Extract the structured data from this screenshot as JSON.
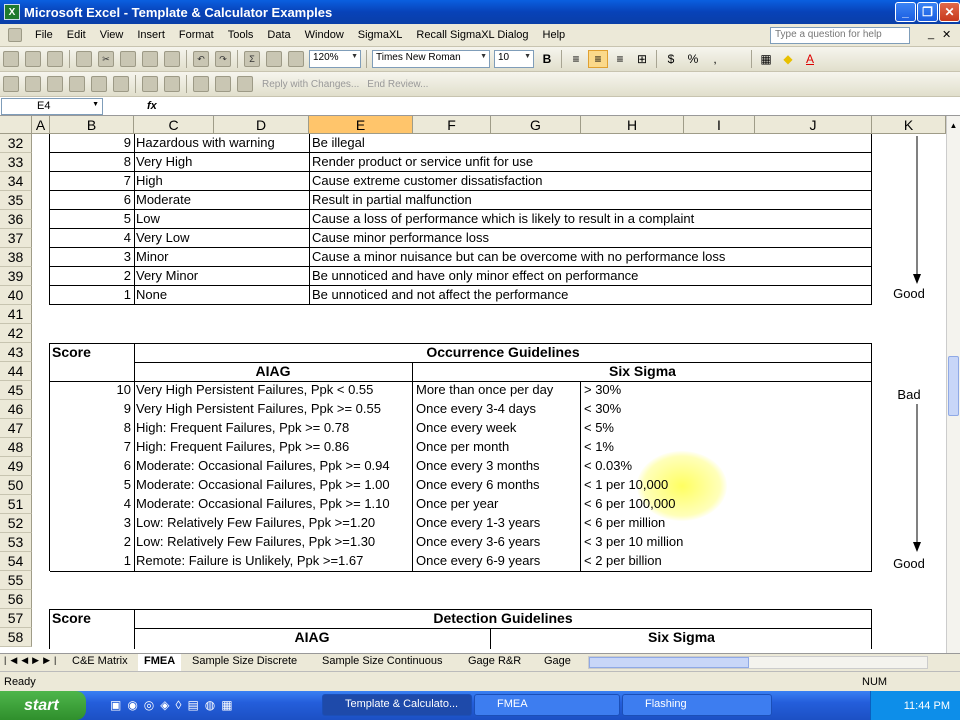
{
  "window": {
    "title": "Microsoft Excel - Template & Calculator Examples"
  },
  "menu": [
    "File",
    "Edit",
    "View",
    "Insert",
    "Format",
    "Tools",
    "Data",
    "Window",
    "SigmaXL",
    "Recall SigmaXL Dialog",
    "Help"
  ],
  "help_placeholder": "Type a question for help",
  "toolbar": {
    "zoom": "120%",
    "font": "Times New Roman",
    "size": "10",
    "reply": "Reply with Changes...",
    "end_review": "End Review..."
  },
  "formula": {
    "namebox": "E4",
    "fx": "fx"
  },
  "columns": [
    "A",
    "B",
    "C",
    "D",
    "E",
    "F",
    "G",
    "H",
    "I",
    "J",
    "K"
  ],
  "rows": [
    "32",
    "33",
    "34",
    "35",
    "36",
    "37",
    "38",
    "39",
    "40",
    "41",
    "42",
    "43",
    "44",
    "45",
    "46",
    "47",
    "48",
    "49",
    "50",
    "51",
    "52",
    "53",
    "54",
    "55",
    "56",
    "57",
    "58"
  ],
  "severity": [
    {
      "n": "9",
      "d": "Hazardous with warning",
      "e": "Be illegal"
    },
    {
      "n": "8",
      "d": "Very High",
      "e": "Render product or service unfit for use"
    },
    {
      "n": "7",
      "d": "High",
      "e": "Cause extreme customer dissatisfaction"
    },
    {
      "n": "6",
      "d": "Moderate",
      "e": "Result in partial malfunction"
    },
    {
      "n": "5",
      "d": "Low",
      "e": "Cause a loss of performance which is likely to result in a complaint"
    },
    {
      "n": "4",
      "d": "Very Low",
      "e": "Cause minor performance loss"
    },
    {
      "n": "3",
      "d": "Minor",
      "e": "Cause a minor nuisance but can be overcome with no performance loss"
    },
    {
      "n": "2",
      "d": "Very Minor",
      "e": "Be unnoticed and have only minor effect on performance"
    },
    {
      "n": "1",
      "d": "None",
      "e": "Be unnoticed and not affect the performance"
    }
  ],
  "occurrence": {
    "score": "Score",
    "title": "Occurrence Guidelines",
    "aiag": "AIAG",
    "sixsigma": "Six Sigma",
    "rows": [
      {
        "n": "10",
        "a": "Very High  Persistent Failures, Ppk < 0.55",
        "f": "More than once per day",
        "s": "> 30%"
      },
      {
        "n": "9",
        "a": "Very High  Persistent Failures, Ppk >= 0.55",
        "f": "Once every 3-4 days",
        "s": "< 30%"
      },
      {
        "n": "8",
        "a": "High: Frequent Failures, Ppk >= 0.78",
        "f": "Once every week",
        "s": "< 5%"
      },
      {
        "n": "7",
        "a": "High: Frequent Failures, Ppk >= 0.86",
        "f": "Once per month",
        "s": "< 1%"
      },
      {
        "n": "6",
        "a": "Moderate: Occasional Failures, Ppk >= 0.94",
        "f": "Once every 3 months",
        "s": "< 0.03%"
      },
      {
        "n": "5",
        "a": "Moderate: Occasional Failures, Ppk >= 1.00",
        "f": "Once every 6 months",
        "s": "< 1 per 10,000"
      },
      {
        "n": "4",
        "a": "Moderate: Occasional Failures, Ppk >= 1.10",
        "f": "Once per year",
        "s": "< 6 per 100,000"
      },
      {
        "n": "3",
        "a": "Low: Relatively Few Failures, Ppk >=1.20",
        "f": "Once every 1-3 years",
        "s": "< 6 per million"
      },
      {
        "n": "2",
        "a": "Low: Relatively Few Failures, Ppk >=1.30",
        "f": "Once every 3-6 years",
        "s": "< 3 per 10 million"
      },
      {
        "n": "1",
        "a": "Remote: Failure is Unlikely, Ppk >=1.67",
        "f": "Once every 6-9 years",
        "s": "< 2 per billion"
      }
    ]
  },
  "detection": {
    "score": "Score",
    "title": "Detection Guidelines",
    "aiag": "AIAG",
    "sixsigma": "Six Sigma"
  },
  "side": {
    "good1": "Good",
    "bad": "Bad",
    "good2": "Good"
  },
  "tabs": [
    "C&E Matrix",
    "FMEA",
    "Sample Size Discrete",
    "Sample Size Continuous",
    "Gage R&R",
    "Gage"
  ],
  "status": {
    "ready": "Ready",
    "num": "NUM"
  },
  "taskbar": {
    "start": "start",
    "tasks": [
      "Template & Calculato...",
      "FMEA",
      "Flashing"
    ],
    "time": "11:44 PM"
  }
}
